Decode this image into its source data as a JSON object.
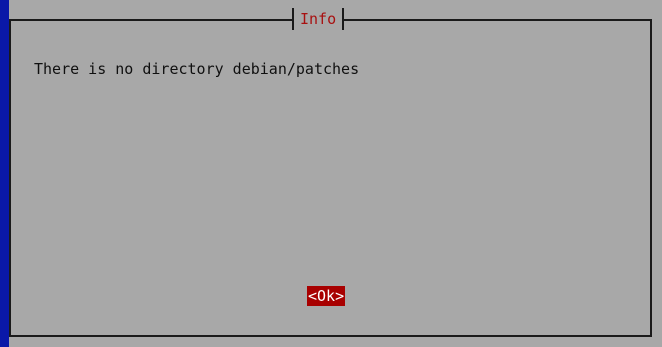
{
  "dialog": {
    "title": "Info",
    "message": "There is no directory debian/patches",
    "ok_label": "<Ok>"
  },
  "colors": {
    "terminal_background": "#0a18a8",
    "dialog_background": "#a8a8a8",
    "title_text": "#a81010",
    "button_background": "#a80000",
    "button_text": "#ffffff"
  }
}
